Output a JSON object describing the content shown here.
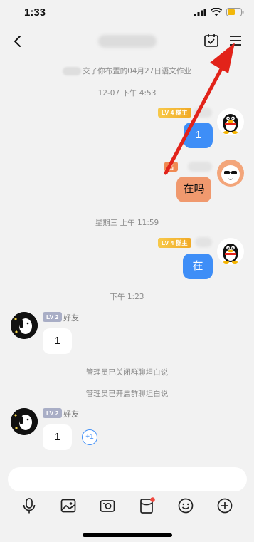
{
  "status_bar": {
    "time": "1:33"
  },
  "nav": {
    "title_blurred": true
  },
  "messages": {
    "homework_notice": "交了你布置的04月27日语文作业",
    "time_1": "12-07 下午 4:53",
    "time_2": "星期三 上午 11:59",
    "time_3": "下午 1:23",
    "admin_muted": "管理员已关闭群聊坦白说",
    "admin_unmuted": "管理员已开启群聊坦白说"
  },
  "badges": {
    "owner": "LV 4 群主",
    "owner_2": "LV 4 群主",
    "orange_suffix": "名",
    "friend_1": "LV 2",
    "friend_2": "LV 2"
  },
  "labels": {
    "friend": "好友",
    "friend_2": "好友"
  },
  "bubbles": {
    "self_1": "1",
    "other_1": "在吗",
    "self_2": "在",
    "friend_msg_1": "1",
    "friend_msg_2": "1"
  },
  "plus_one": "+1",
  "input": {
    "value": ""
  },
  "colors": {
    "accent_blue": "#3e8ef7",
    "bubble_orange": "#f0996e",
    "arrow_red": "#e2231a",
    "badge_gold": "#f1a924"
  },
  "toolbar": [
    "mic-icon",
    "image-icon",
    "camera-icon",
    "redpacket-icon",
    "emoji-icon",
    "plus-icon"
  ]
}
